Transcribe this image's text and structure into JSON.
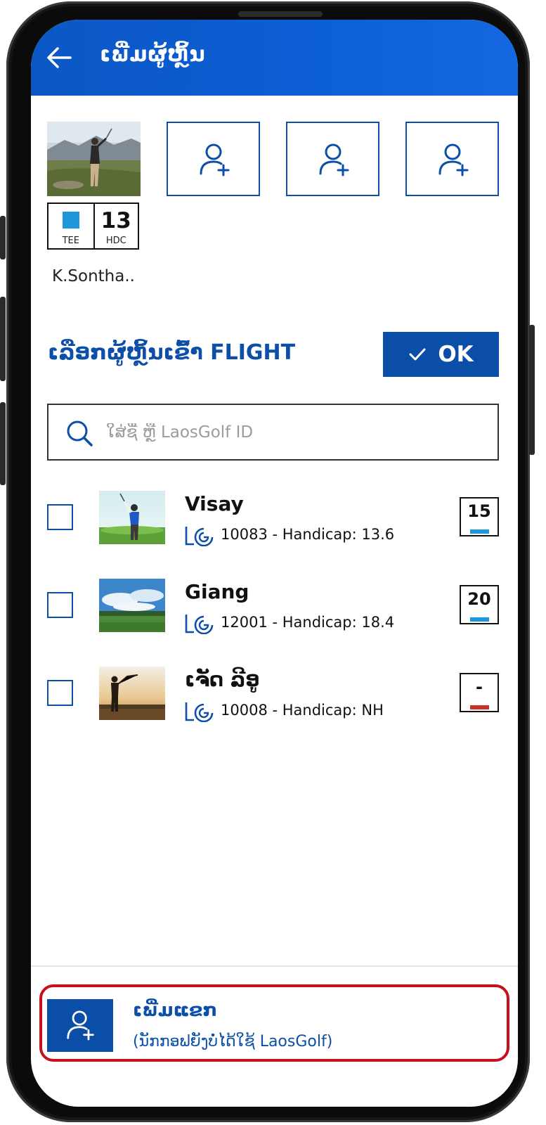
{
  "header": {
    "title": "ເພີ່ມຜູ້ຫຼິ້ນ",
    "back_icon": "arrow-left-icon"
  },
  "flight": {
    "player": {
      "name": "K.Sontha..",
      "tee_label": "TEE",
      "tee_color": "#1e96dc",
      "hdc_value": "13",
      "hdc_label": "HDC"
    },
    "empty_slot_icon": "add-user-icon"
  },
  "section": {
    "title": "ເລືອກຜູ້ຫຼິ້ນເຂົ້າ FLIGHT",
    "ok_label": "OK",
    "ok_icon": "check-icon"
  },
  "search": {
    "placeholder": "ໃສ່ຊື່ ຫຼື LaosGolf ID",
    "value": "",
    "icon": "search-icon"
  },
  "players": [
    {
      "name": "Visay",
      "info": "10083 - Handicap: 13.6",
      "hc": "15",
      "tee_color": "#1e96dc",
      "checked": false
    },
    {
      "name": "Giang",
      "info": "12001 - Handicap: 18.4",
      "hc": "20",
      "tee_color": "#1e96dc",
      "checked": false
    },
    {
      "name": "ເຈັດ ລີອູ",
      "info": "10008 - Handicap: NH",
      "hc": "-",
      "tee_color": "#c8322b",
      "checked": false
    }
  ],
  "guest": {
    "title": "ເພີ່ມແຂກ",
    "subtitle": "(ນັກກອຟຍັງບໍ່ໄດ້ໃຊ້ LaosGolf)",
    "icon": "add-user-icon"
  },
  "colors": {
    "primary": "#0b4ea8",
    "highlight_border": "#c8101c"
  }
}
